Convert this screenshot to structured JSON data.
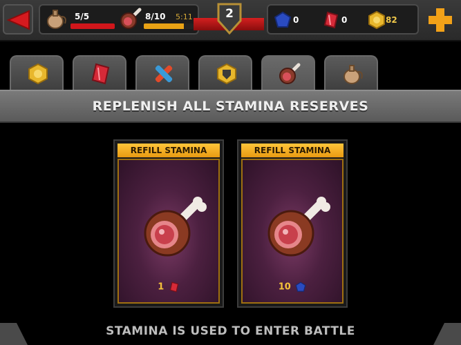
{
  "hud": {
    "water": {
      "value": "5/5",
      "fill": 1.0,
      "icon": "water-jug-icon",
      "bar_color": "#d0161b"
    },
    "stamina": {
      "value": "8/10",
      "fill": 0.8,
      "timer": "5:11",
      "icon": "meat-icon",
      "bar_color": "#e8a215"
    },
    "rank": {
      "level": "2"
    },
    "blue_gems": {
      "value": "0",
      "icon": "blue-gem-icon"
    },
    "red_gems": {
      "value": "0",
      "icon": "red-gem-icon"
    },
    "gold": {
      "value": "82",
      "icon": "gold-coin-icon"
    }
  },
  "tabs": [
    {
      "icon": "gold-coin-icon",
      "active": false
    },
    {
      "icon": "red-gem-icon",
      "active": false
    },
    {
      "icon": "bandage-icon",
      "active": false
    },
    {
      "icon": "shield-badge-icon",
      "active": false
    },
    {
      "icon": "meat-icon",
      "active": true
    },
    {
      "icon": "water-jug-icon",
      "active": false
    }
  ],
  "banner": {
    "title": "REPLENISH ALL STAMINA RESERVES"
  },
  "cards": [
    {
      "header": "REFILL STAMINA",
      "price": "1",
      "currency_icon": "red-gem-icon"
    },
    {
      "header": "REFILL STAMINA",
      "price": "10",
      "currency_icon": "blue-gem-icon"
    }
  ],
  "footer": {
    "text": "STAMINA IS USED TO ENTER BATTLE"
  },
  "colors": {
    "accent_gold": "#f5c23a",
    "header_orange": "#ffb52a",
    "red": "#d0161b",
    "card_purple": "#4c2040"
  }
}
